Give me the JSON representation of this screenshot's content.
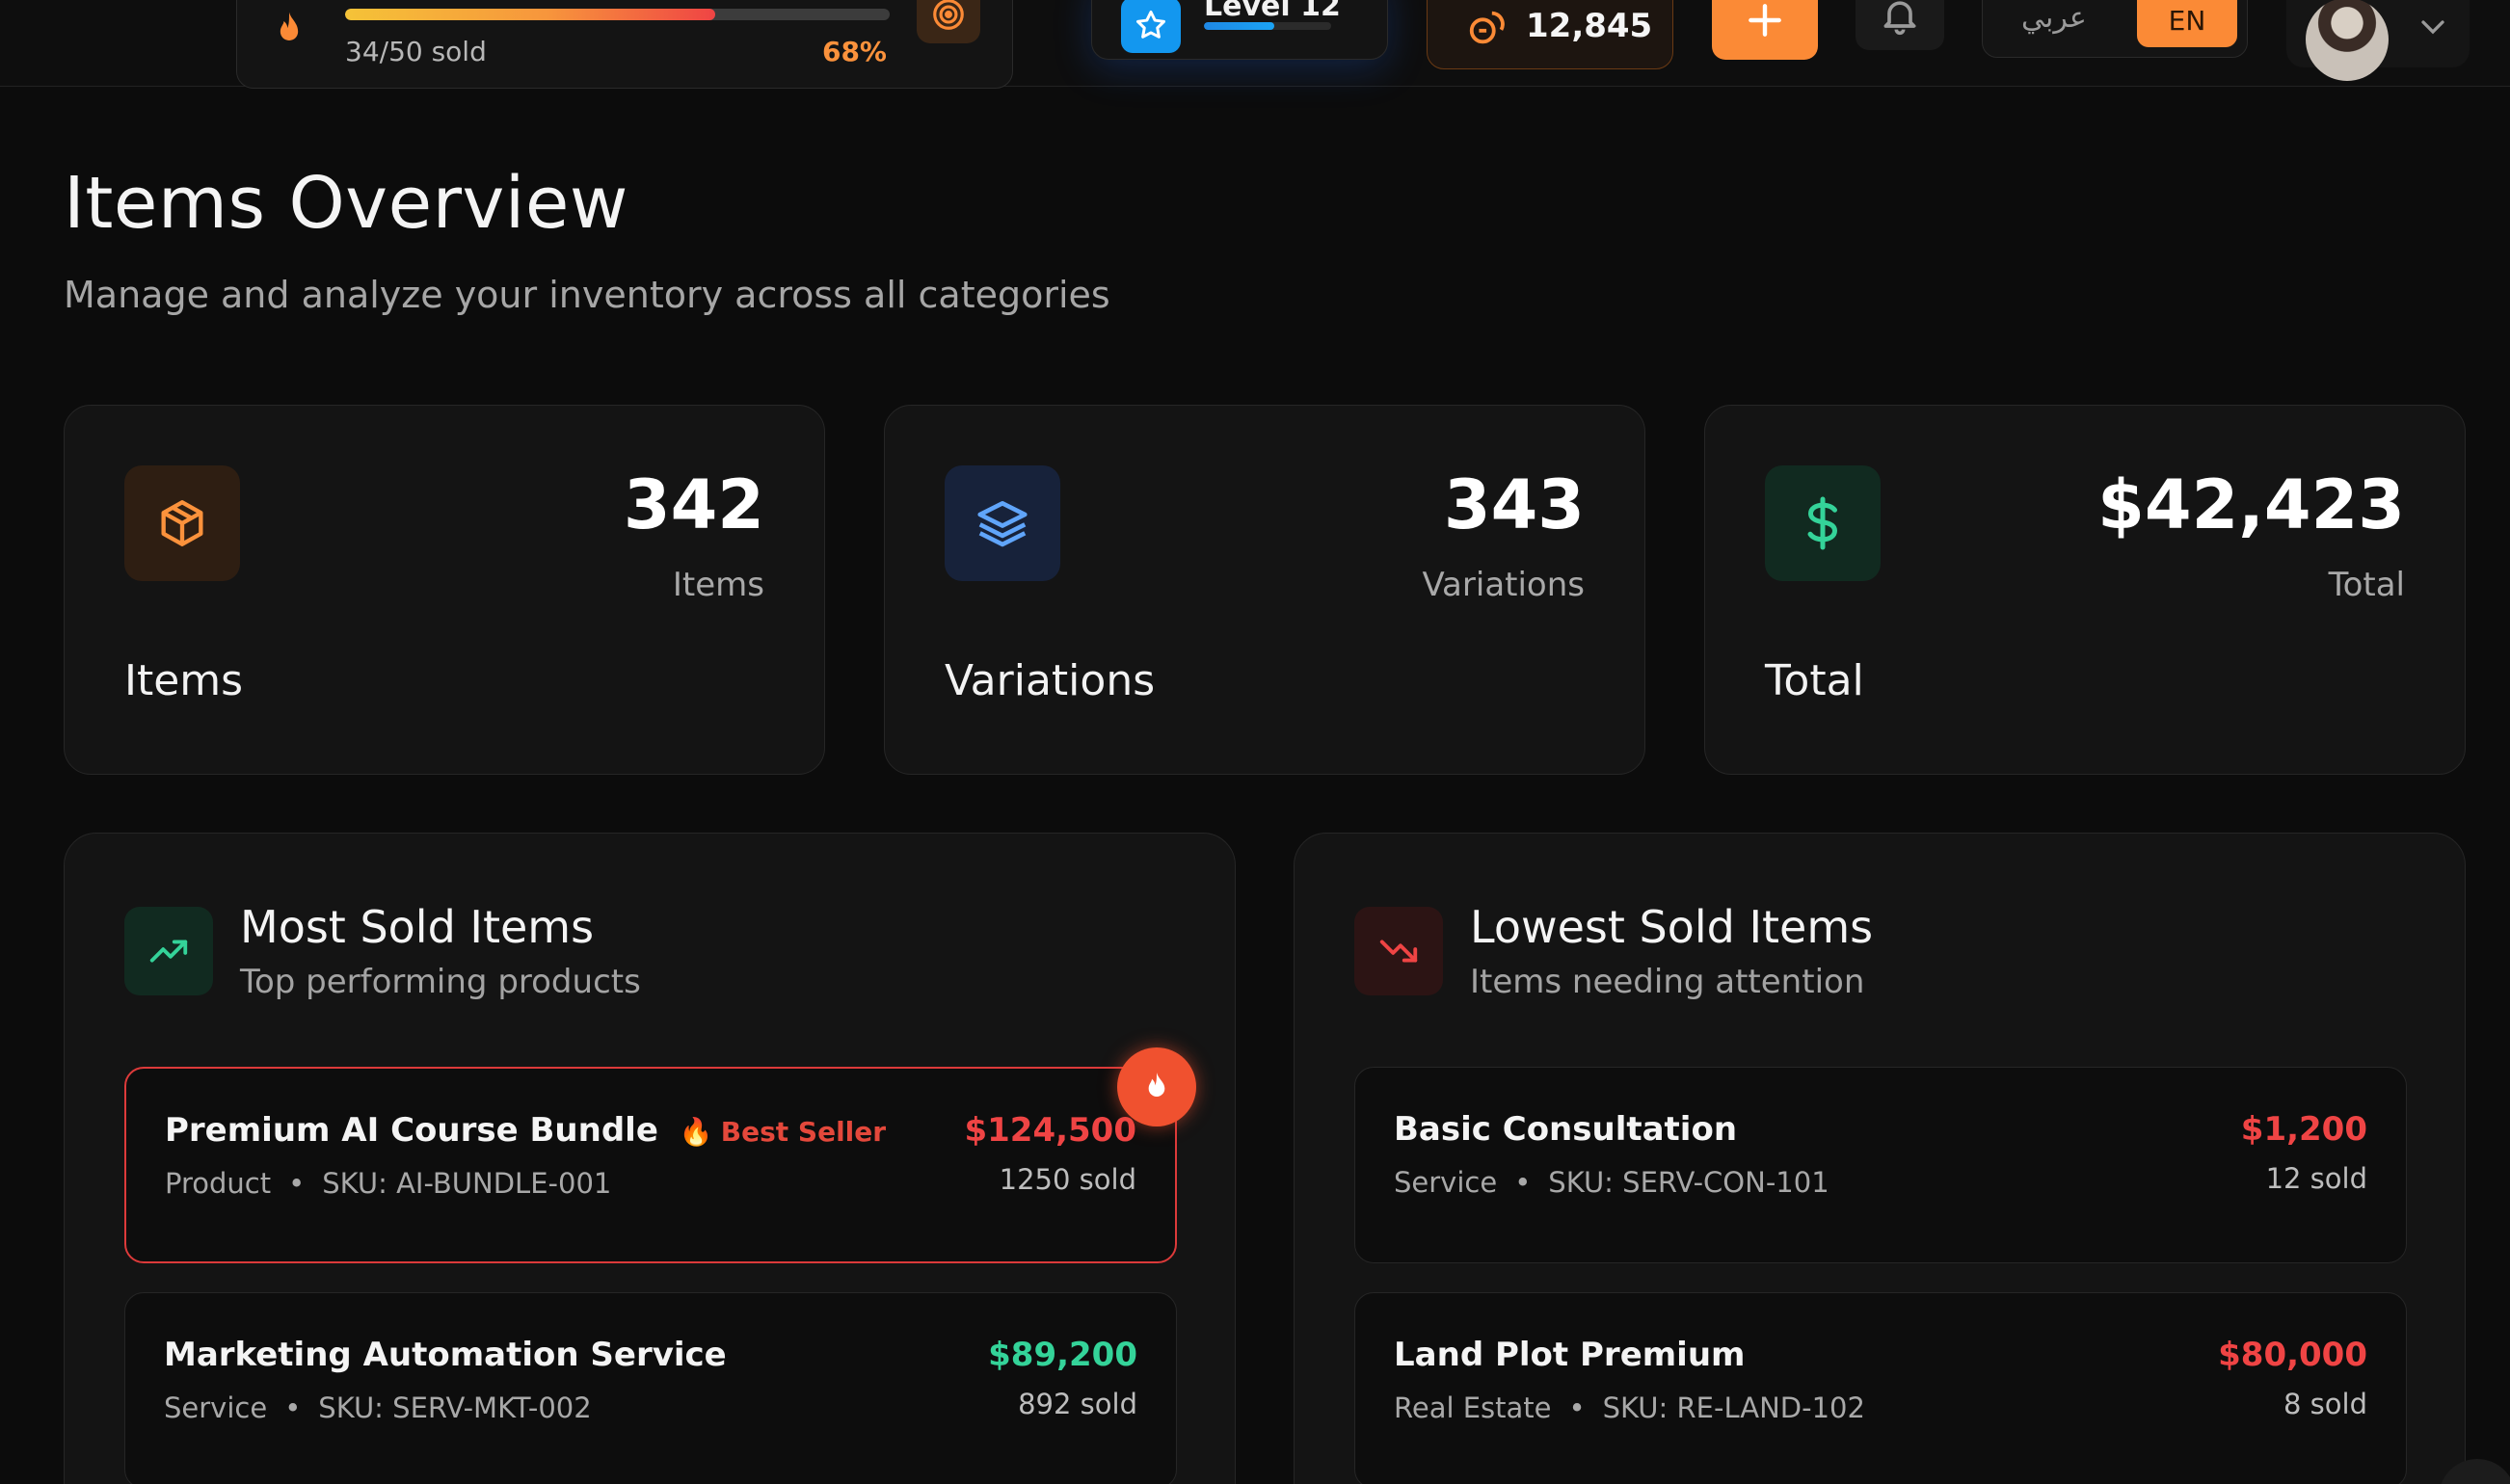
{
  "topbar": {
    "goal": {
      "sold_text": "34/50 sold",
      "percent_text": "68%",
      "progress": 0.68
    },
    "level": {
      "label": "Level 12",
      "progress": 0.55
    },
    "points": {
      "value": "12,845"
    },
    "language": {
      "arabic_label": "عربي",
      "english_label": "EN"
    }
  },
  "header": {
    "title": "Items Overview",
    "subtitle": "Manage and analyze your inventory across all categories"
  },
  "stats": [
    {
      "number": "342",
      "unit": "Items",
      "label": "Items",
      "icon": "box-icon",
      "accent": "#fb923c"
    },
    {
      "number": "343",
      "unit": "Variations",
      "label": "Variations",
      "icon": "layers-icon",
      "accent": "#60a5fa"
    },
    {
      "number": "$42,423",
      "unit": "Total",
      "label": "Total",
      "icon": "dollar-icon",
      "accent": "#34d399"
    }
  ],
  "most_sold": {
    "title": "Most Sold Items",
    "subtitle": "Top performing products",
    "items": [
      {
        "name": "Premium AI Course Bundle",
        "badge": "Best Seller",
        "category": "Product",
        "sku": "SKU: AI-BUNDLE-001",
        "price": "$124,500",
        "sold": "1250 sold",
        "price_color": "#ef4444"
      },
      {
        "name": "Marketing Automation Service",
        "category": "Service",
        "sku": "SKU: SERV-MKT-002",
        "price": "$89,200",
        "sold": "892 sold",
        "price_color": "#34d399"
      }
    ]
  },
  "lowest_sold": {
    "title": "Lowest Sold Items",
    "subtitle": "Items needing attention",
    "items": [
      {
        "name": "Basic Consultation",
        "category": "Service",
        "sku": "SKU: SERV-CON-101",
        "price": "$1,200",
        "sold": "12 sold",
        "price_color": "#ef4444"
      },
      {
        "name": "Land Plot Premium",
        "category": "Real Estate",
        "sku": "SKU: RE-LAND-102",
        "price": "$80,000",
        "sold": "8 sold",
        "price_color": "#ef4444"
      }
    ]
  },
  "colors": {
    "accent_orange": "#fb8a36",
    "bg": "#0c0c0c",
    "card": "#141414"
  }
}
